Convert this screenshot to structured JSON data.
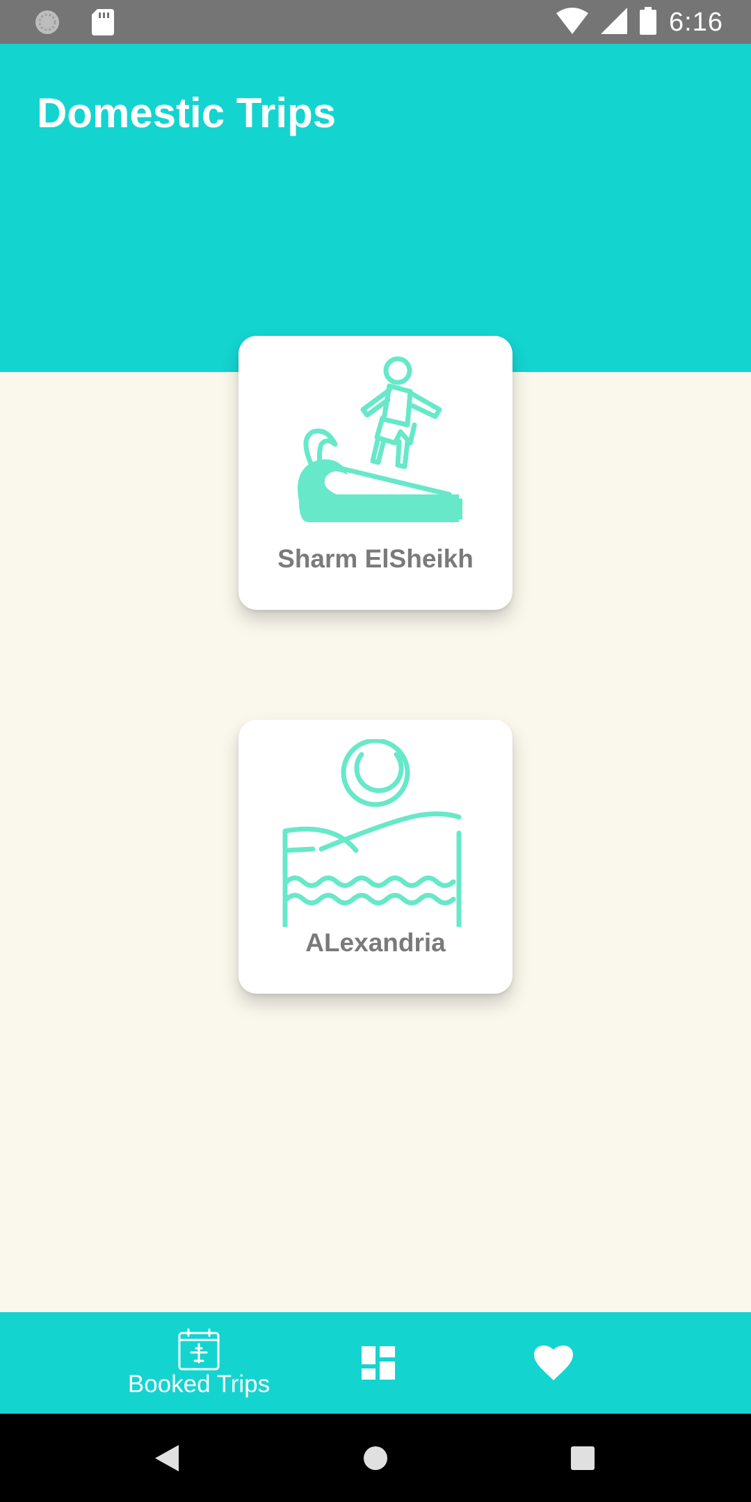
{
  "status_bar": {
    "time": "6:16",
    "icons": [
      "sync-icon",
      "sd-card-icon",
      "wifi-icon",
      "signal-icon",
      "battery-icon"
    ]
  },
  "header": {
    "title": "Domestic Trips",
    "color": "#14D4D0"
  },
  "destinations": [
    {
      "label": "Sharm ElSheikh",
      "icon": "surfer-icon"
    },
    {
      "label": "ALexandria",
      "icon": "beach-sun-icon"
    }
  ],
  "bottom_nav": {
    "items": [
      {
        "label": "Booked Trips",
        "icon": "calendar-plane-icon",
        "active": true
      },
      {
        "label": "",
        "icon": "dashboard-icon",
        "active": false
      },
      {
        "label": "",
        "icon": "heart-icon",
        "active": false
      }
    ]
  },
  "system_nav": {
    "buttons": [
      "back-icon",
      "home-icon",
      "recents-icon"
    ]
  },
  "colors": {
    "primary": "#14D4D0",
    "illustration": "#67E8C9",
    "background": "#FAF7EC",
    "label": "#7A7A7A"
  }
}
